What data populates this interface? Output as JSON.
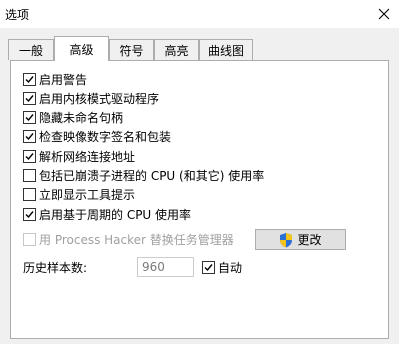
{
  "window": {
    "title": "选项"
  },
  "tabs": [
    {
      "label": "一般",
      "active": false
    },
    {
      "label": "高级",
      "active": true
    },
    {
      "label": "符号",
      "active": false
    },
    {
      "label": "高亮",
      "active": false
    },
    {
      "label": "曲线图",
      "active": false
    }
  ],
  "options": [
    {
      "label": "启用警告",
      "checked": true
    },
    {
      "label": "启用内核模式驱动程序",
      "checked": true
    },
    {
      "label": "隐藏未命名句柄",
      "checked": true
    },
    {
      "label": "检查映像数字签名和包装",
      "checked": true
    },
    {
      "label": "解析网络连接地址",
      "checked": true
    },
    {
      "label": "包括已崩溃子进程的 CPU (和其它) 使用率",
      "checked": false
    },
    {
      "label": "立即显示工具提示",
      "checked": false
    },
    {
      "label": "启用基于周期的 CPU 使用率",
      "checked": true
    }
  ],
  "replace_task_manager": {
    "label": "用 Process Hacker 替换任务管理器",
    "checked": false,
    "enabled": false
  },
  "change_button": {
    "label": "更改"
  },
  "history": {
    "label": "历史样本数:",
    "value": "960"
  },
  "auto": {
    "label": "自动",
    "checked": true
  },
  "colors": {
    "shield_blue": "#2a6fd6",
    "shield_yellow": "#f2c318"
  }
}
